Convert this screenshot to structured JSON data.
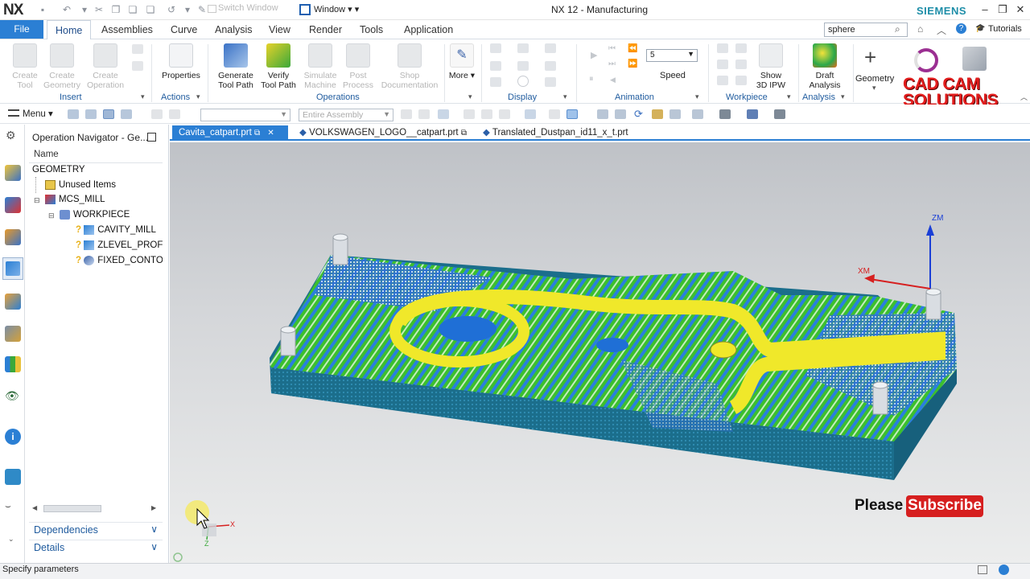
{
  "app": {
    "logo": "NX",
    "title": "NX 12 - Manufacturing",
    "vendor": "SIEMENS",
    "switch_window": "Switch Window",
    "window_menu": "Window"
  },
  "tabs": {
    "file": "File",
    "items": [
      "Home",
      "Assemblies",
      "Curve",
      "Analysis",
      "View",
      "Render",
      "Tools",
      "Application"
    ],
    "active": "Home"
  },
  "search": {
    "value": "sphere"
  },
  "tutorials": "Tutorials",
  "ribbon": {
    "insert": {
      "label": "Insert",
      "buttons": [
        "Create\nTool",
        "Create\nGeometry",
        "Create\nOperation"
      ]
    },
    "actions": {
      "label": "Actions",
      "buttons": [
        "Properties"
      ]
    },
    "operations": {
      "label": "Operations",
      "buttons": [
        "Generate\nTool Path",
        "Verify\nTool Path",
        "Simulate\nMachine",
        "Post\nProcess",
        "Shop\nDocumentation"
      ]
    },
    "more": "More",
    "display": {
      "label": "Display"
    },
    "animation": {
      "label": "Animation",
      "speed_value": "5",
      "speed_label": "Speed"
    },
    "workpiece": {
      "label": "Workpiece",
      "show_ipw": "Show\n3D IPW"
    },
    "analysis": {
      "label": "Analysis",
      "draft": "Draft\nAnalysis"
    },
    "geometry": "Geometry"
  },
  "watermark": {
    "line1": "CAD CAM",
    "line2": "SOLUTIONS"
  },
  "command_bar": {
    "menu": "Menu",
    "assembly_filter": "Entire Assembly"
  },
  "navigator": {
    "title": "Operation Navigator - Ge...",
    "column": "Name",
    "tree": [
      {
        "label": "GEOMETRY",
        "level": 0
      },
      {
        "label": "Unused Items",
        "level": 1
      },
      {
        "label": "MCS_MILL",
        "level": 1
      },
      {
        "label": "WORKPIECE",
        "level": 2
      },
      {
        "label": "CAVITY_MILL",
        "level": 3
      },
      {
        "label": "ZLEVEL_PROFIL",
        "level": 3
      },
      {
        "label": "FIXED_CONTOU",
        "level": 3
      }
    ],
    "dependencies": "Dependencies",
    "details": "Details"
  },
  "file_tabs": [
    "Cavita_catpart.prt",
    "VOLKSWAGEN_LOGO__catpart.prt",
    "Translated_Dustpan_id11_x_t.prt"
  ],
  "viewport": {
    "axis_zm": "ZM",
    "axis_xm": "XM",
    "triad_x": "X",
    "triad_z": "Z"
  },
  "overlay": {
    "please": "Please",
    "subscribe": "Subscribe"
  },
  "status": "Specify parameters",
  "colors": {
    "accent": "#2b7fd4",
    "model_green": "#3cbf2e",
    "model_blue": "#1f6fd6",
    "model_yellow": "#f0e82a",
    "base_teal": "#1b6e8c",
    "subscribe_red": "#d61f1f",
    "watermark_red": "#e21d1d"
  }
}
